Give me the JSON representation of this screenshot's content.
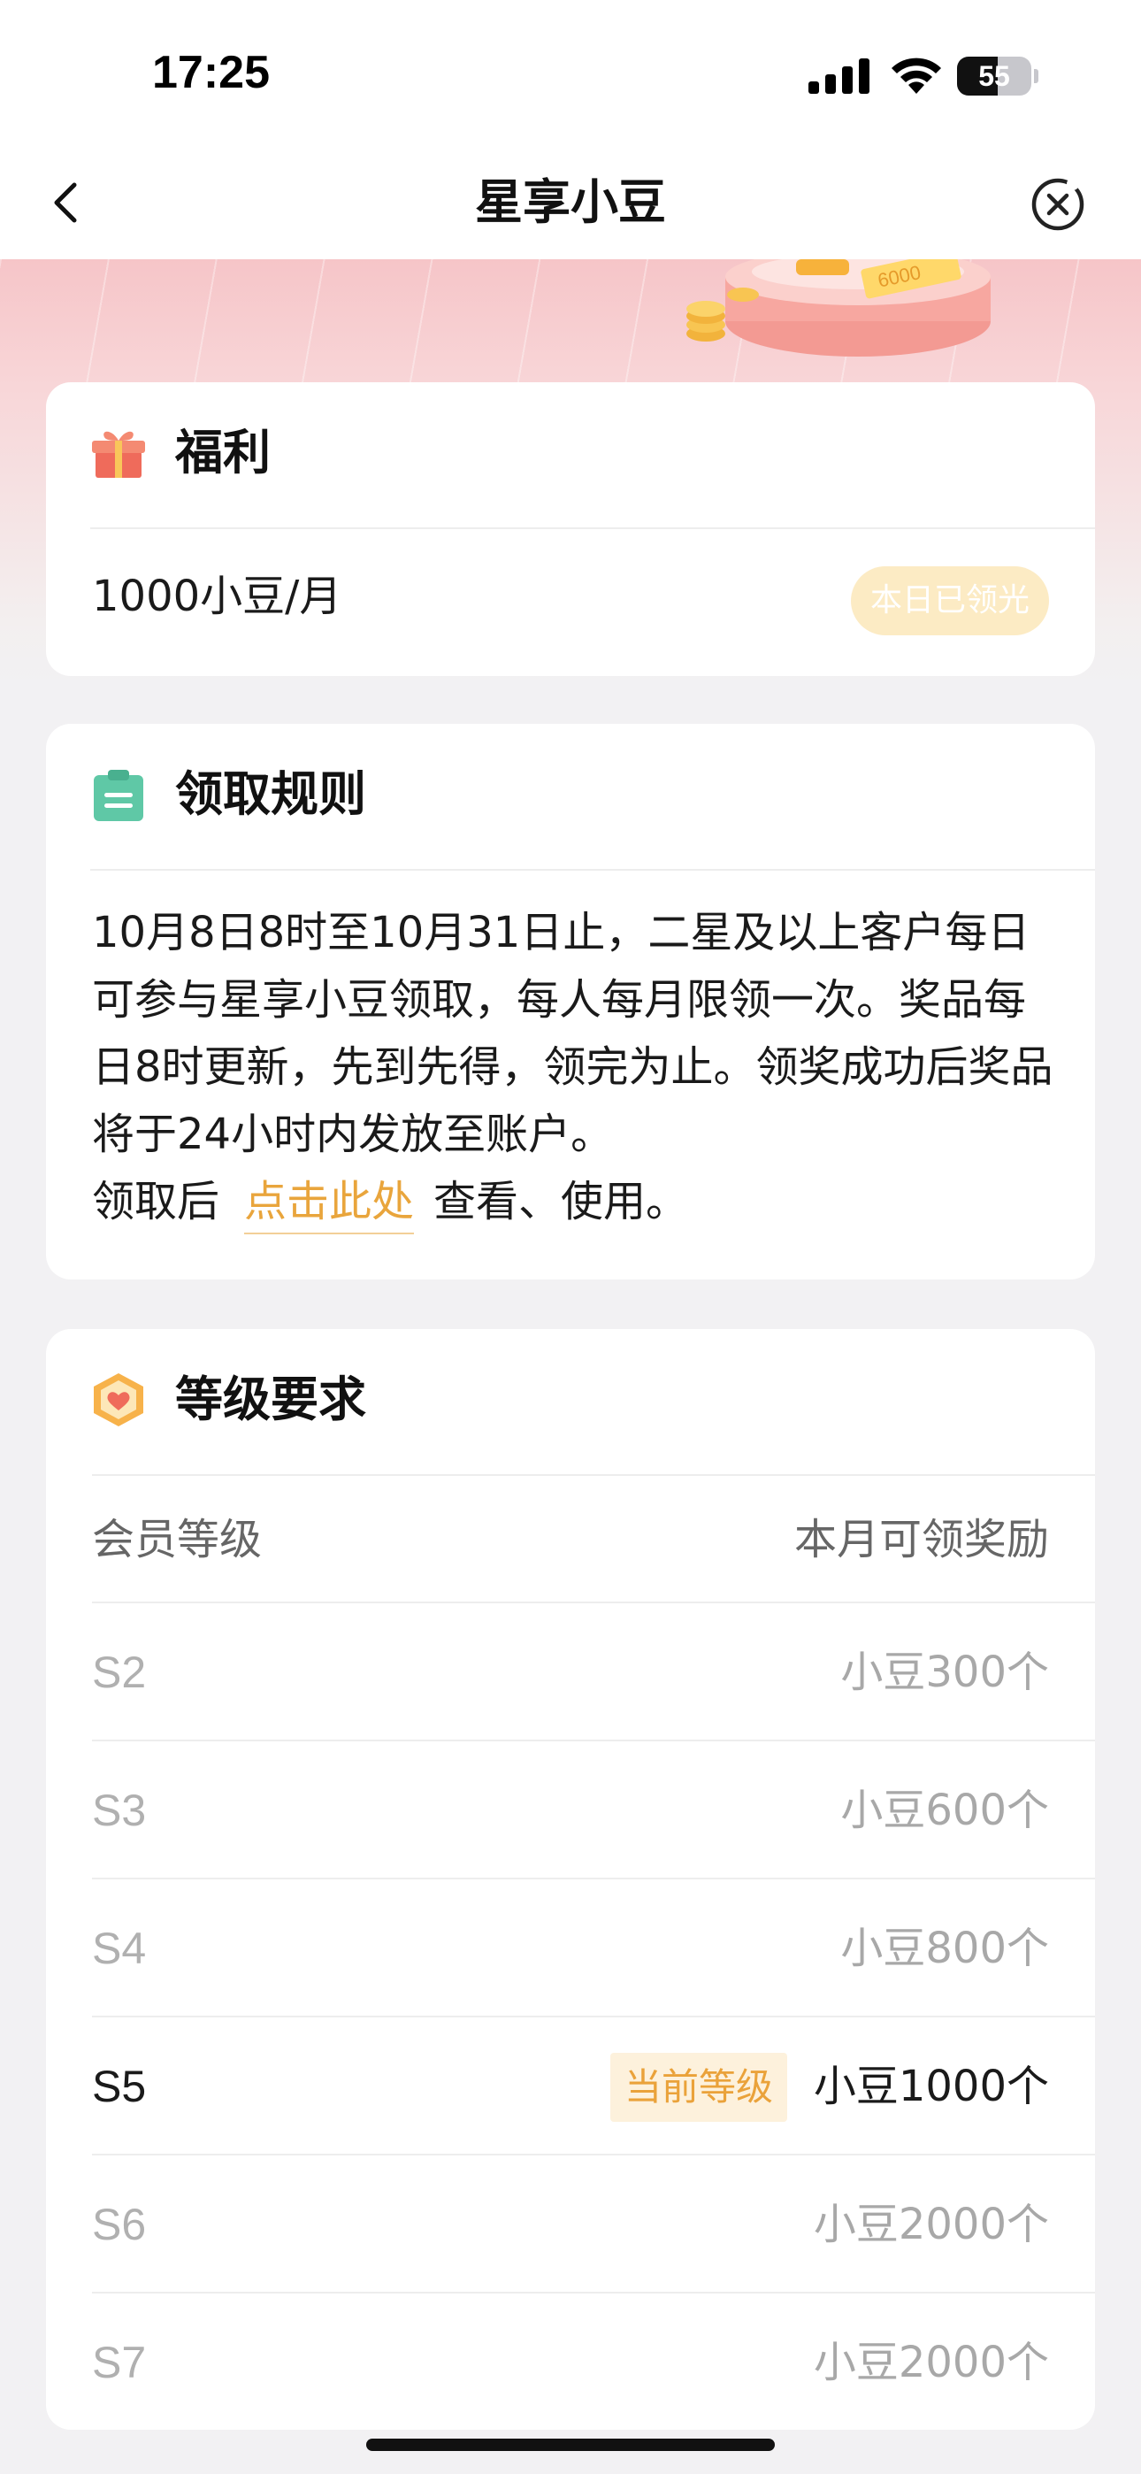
{
  "status_bar": {
    "time": "17:25",
    "battery": "55",
    "battery_level_percent": 55,
    "icons": [
      "signal-icon",
      "wifi-icon",
      "battery-icon"
    ]
  },
  "nav": {
    "title": "星享小豆",
    "back_icon": "chevron-left-icon",
    "close_icon": "close-circle-icon"
  },
  "benefit": {
    "title": "福利",
    "icon": "gift-icon",
    "value": "1000小豆/月",
    "status": "本日已领光"
  },
  "rules": {
    "title": "领取规则",
    "icon": "clipboard-icon",
    "text": "10月8日8时至10月31日止，二星及以上客户每日可参与星享小豆领取，每人每月限领一次。奖品每日8时更新，先到先得，领完为止。领奖成功后奖品将于24小时内发放至账户。",
    "footer_prefix": "领取后",
    "footer_link": "点击此处",
    "footer_suffix": "查看、使用。"
  },
  "levels": {
    "title": "等级要求",
    "icon": "level-badge-icon",
    "col_level": "会员等级",
    "col_reward": "本月可领奖励",
    "current_label": "当前等级",
    "rows": [
      {
        "level": "S2",
        "reward": "小豆300个"
      },
      {
        "level": "S3",
        "reward": "小豆600个"
      },
      {
        "level": "S4",
        "reward": "小豆800个"
      },
      {
        "level": "S5",
        "reward": "小豆1000个",
        "current": true
      },
      {
        "level": "S6",
        "reward": "小豆2000个"
      },
      {
        "level": "S7",
        "reward": "小豆2000个"
      }
    ]
  },
  "colors": {
    "accent": "#E9A53C",
    "badge_bg": "#FCEBC4",
    "banner_pink": "#F6C5C8",
    "gift_red": "#EE6A5A",
    "clipboard_green": "#5FC8A6"
  }
}
